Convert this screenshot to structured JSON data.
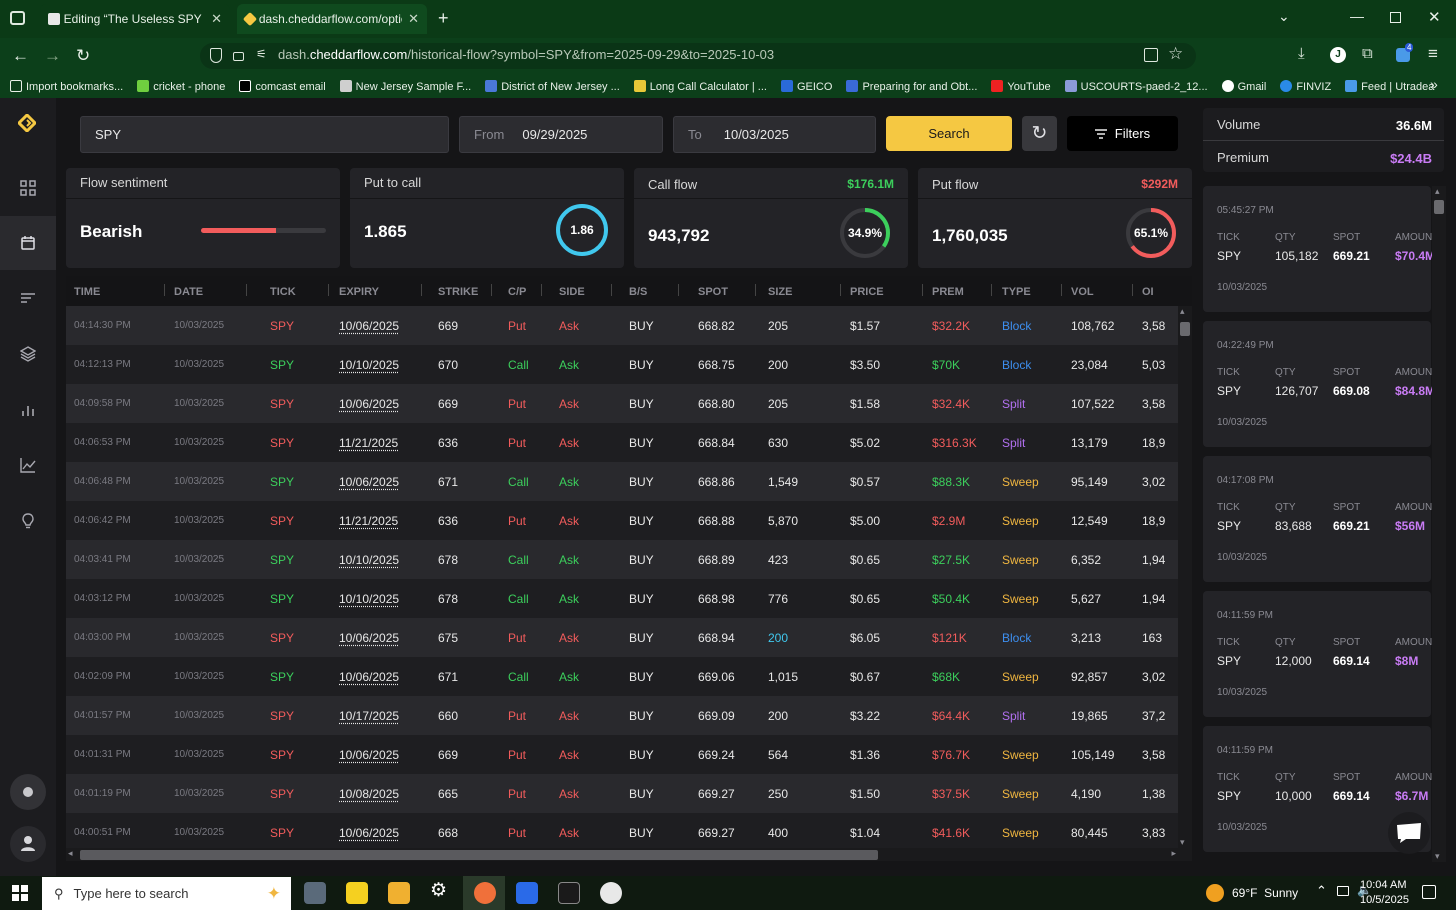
{
  "browser": {
    "tabs": [
      {
        "title": "Editing “The Useless SPY Report”",
        "active": false
      },
      {
        "title": "dash.cheddarflow.com/options-",
        "active": true
      }
    ],
    "url_prefix": "dash.",
    "url_domain": "cheddarflow.com",
    "url_path": "/historical-flow?symbol=SPY&from=2025-09-29&to=2025-10-03",
    "extension_badge": "4",
    "bookmarks": [
      {
        "label": "Import bookmarks...",
        "icon_color": "#e8f0e8"
      },
      {
        "label": "cricket - phone",
        "icon_color": "#6fcf3f"
      },
      {
        "label": "comcast email",
        "icon_color": "#ffffff"
      },
      {
        "label": "New Jersey Sample F...",
        "icon_color": "#cfcfcf"
      },
      {
        "label": "District of New Jersey ...",
        "icon_color": "#4a78d8"
      },
      {
        "label": "Long Call Calculator | ...",
        "icon_color": "#e8c838"
      },
      {
        "label": "GEICO",
        "icon_color": "#2a6ad8"
      },
      {
        "label": "Preparing for and Obt...",
        "icon_color": "#3a6ad8"
      },
      {
        "label": "YouTube",
        "icon_color": "#ee2222"
      },
      {
        "label": "USCOURTS-paed-2_12...",
        "icon_color": "#8a9ad8"
      },
      {
        "label": "Gmail",
        "icon_color": "#ffffff"
      },
      {
        "label": "FINVIZ",
        "icon_color": "#2a8ae8"
      },
      {
        "label": "Feed | Utradea",
        "icon_color": "#4a9ae8"
      }
    ]
  },
  "search": {
    "symbol_value": "SPY",
    "from_label": "From",
    "from_value": "09/29/2025",
    "to_label": "To",
    "to_value": "10/03/2025",
    "search_label": "Search",
    "filters_label": "Filters"
  },
  "stats": {
    "sentiment": {
      "title": "Flow sentiment",
      "value": "Bearish",
      "bar_fraction": 0.6
    },
    "put_to_call": {
      "title": "Put to call",
      "value": "1.865",
      "ring_label": "1.86"
    },
    "call_flow": {
      "title": "Call flow",
      "premium": "$176.1M",
      "value": "943,792",
      "ring_label": "34.9%",
      "ring_fraction": 0.349
    },
    "put_flow": {
      "title": "Put flow",
      "premium": "$292M",
      "value": "1,760,035",
      "ring_label": "65.1%",
      "ring_fraction": 0.651
    }
  },
  "table": {
    "headers": [
      "TIME",
      "DATE",
      "TICK",
      "EXPIRY",
      "STRIKE",
      "C/P",
      "SIDE",
      "B/S",
      "SPOT",
      "SIZE",
      "PRICE",
      "PREM",
      "TYPE",
      "VOL",
      "OI"
    ],
    "rows": [
      [
        "04:14:30 PM",
        "10/03/2025",
        "SPY",
        "10/06/2025",
        "669",
        "Put",
        "Ask",
        "BUY",
        "668.82",
        "205",
        "$1.57",
        "$32.2K",
        "Block",
        "108,762",
        "3,58"
      ],
      [
        "04:12:13 PM",
        "10/03/2025",
        "SPY",
        "10/10/2025",
        "670",
        "Call",
        "Ask",
        "BUY",
        "668.75",
        "200",
        "$3.50",
        "$70K",
        "Block",
        "23,084",
        "5,03"
      ],
      [
        "04:09:58 PM",
        "10/03/2025",
        "SPY",
        "10/06/2025",
        "669",
        "Put",
        "Ask",
        "BUY",
        "668.80",
        "205",
        "$1.58",
        "$32.4K",
        "Split",
        "107,522",
        "3,58"
      ],
      [
        "04:06:53 PM",
        "10/03/2025",
        "SPY",
        "11/21/2025",
        "636",
        "Put",
        "Ask",
        "BUY",
        "668.84",
        "630",
        "$5.02",
        "$316.3K",
        "Split",
        "13,179",
        "18,9"
      ],
      [
        "04:06:48 PM",
        "10/03/2025",
        "SPY",
        "10/06/2025",
        "671",
        "Call",
        "Ask",
        "BUY",
        "668.86",
        "1,549",
        "$0.57",
        "$88.3K",
        "Sweep",
        "95,149",
        "3,02"
      ],
      [
        "04:06:42 PM",
        "10/03/2025",
        "SPY",
        "11/21/2025",
        "636",
        "Put",
        "Ask",
        "BUY",
        "668.88",
        "5,870",
        "$5.00",
        "$2.9M",
        "Sweep",
        "12,549",
        "18,9"
      ],
      [
        "04:03:41 PM",
        "10/03/2025",
        "SPY",
        "10/10/2025",
        "678",
        "Call",
        "Ask",
        "BUY",
        "668.89",
        "423",
        "$0.65",
        "$27.5K",
        "Sweep",
        "6,352",
        "1,94"
      ],
      [
        "04:03:12 PM",
        "10/03/2025",
        "SPY",
        "10/10/2025",
        "678",
        "Call",
        "Ask",
        "BUY",
        "668.98",
        "776",
        "$0.65",
        "$50.4K",
        "Sweep",
        "5,627",
        "1,94"
      ],
      [
        "04:03:00 PM",
        "10/03/2025",
        "SPY",
        "10/06/2025",
        "675",
        "Put",
        "Ask",
        "BUY",
        "668.94",
        "200",
        "$6.05",
        "$121K",
        "Block",
        "3,213",
        "163"
      ],
      [
        "04:02:09 PM",
        "10/03/2025",
        "SPY",
        "10/06/2025",
        "671",
        "Call",
        "Ask",
        "BUY",
        "669.06",
        "1,015",
        "$0.67",
        "$68K",
        "Sweep",
        "92,857",
        "3,02"
      ],
      [
        "04:01:57 PM",
        "10/03/2025",
        "SPY",
        "10/17/2025",
        "660",
        "Put",
        "Ask",
        "BUY",
        "669.09",
        "200",
        "$3.22",
        "$64.4K",
        "Split",
        "19,865",
        "37,2"
      ],
      [
        "04:01:31 PM",
        "10/03/2025",
        "SPY",
        "10/06/2025",
        "669",
        "Put",
        "Ask",
        "BUY",
        "669.24",
        "564",
        "$1.36",
        "$76.7K",
        "Sweep",
        "105,149",
        "3,58"
      ],
      [
        "04:01:19 PM",
        "10/03/2025",
        "SPY",
        "10/08/2025",
        "665",
        "Put",
        "Ask",
        "BUY",
        "669.27",
        "250",
        "$1.50",
        "$37.5K",
        "Sweep",
        "4,190",
        "1,38"
      ],
      [
        "04:00:51 PM",
        "10/03/2025",
        "SPY",
        "10/06/2025",
        "668",
        "Put",
        "Ask",
        "BUY",
        "669.27",
        "400",
        "$1.04",
        "$41.6K",
        "Sweep",
        "80,445",
        "3,83"
      ]
    ]
  },
  "summary": {
    "volume_label": "Volume",
    "volume_value": "36.6M",
    "premium_label": "Premium",
    "premium_value": "$24.4B"
  },
  "trades": {
    "headers": {
      "tick": "TICK",
      "qty": "QTY",
      "spot": "SPOT",
      "amount": "AMOUNT"
    },
    "items": [
      {
        "time": "05:45:27 PM",
        "tick": "SPY",
        "qty": "105,182",
        "spot": "669.21",
        "amount": "$70.4M",
        "date": "10/03/2025"
      },
      {
        "time": "04:22:49 PM",
        "tick": "SPY",
        "qty": "126,707",
        "spot": "669.08",
        "amount": "$84.8M",
        "date": "10/03/2025"
      },
      {
        "time": "04:17:08 PM",
        "tick": "SPY",
        "qty": "83,688",
        "spot": "669.21",
        "amount": "$56M",
        "date": "10/03/2025"
      },
      {
        "time": "04:11:59 PM",
        "tick": "SPY",
        "qty": "12,000",
        "spot": "669.14",
        "amount": "$8M",
        "date": "10/03/2025"
      },
      {
        "time": "04:11:59 PM",
        "tick": "SPY",
        "qty": "10,000",
        "spot": "669.14",
        "amount": "$6.7M",
        "date": "10/03/2025"
      }
    ]
  },
  "taskbar": {
    "search_placeholder": "Type here to search",
    "weather": "69°F  Sunny",
    "time": "10:04 AM",
    "date": "10/5/2025"
  },
  "colors": {
    "accent": "#f5c842",
    "call": "#3ccf5c",
    "put": "#f25c5c",
    "block": "#3d8ff0",
    "split": "#b270f0",
    "sweep": "#f0b640",
    "amount": "#c97cf5"
  }
}
